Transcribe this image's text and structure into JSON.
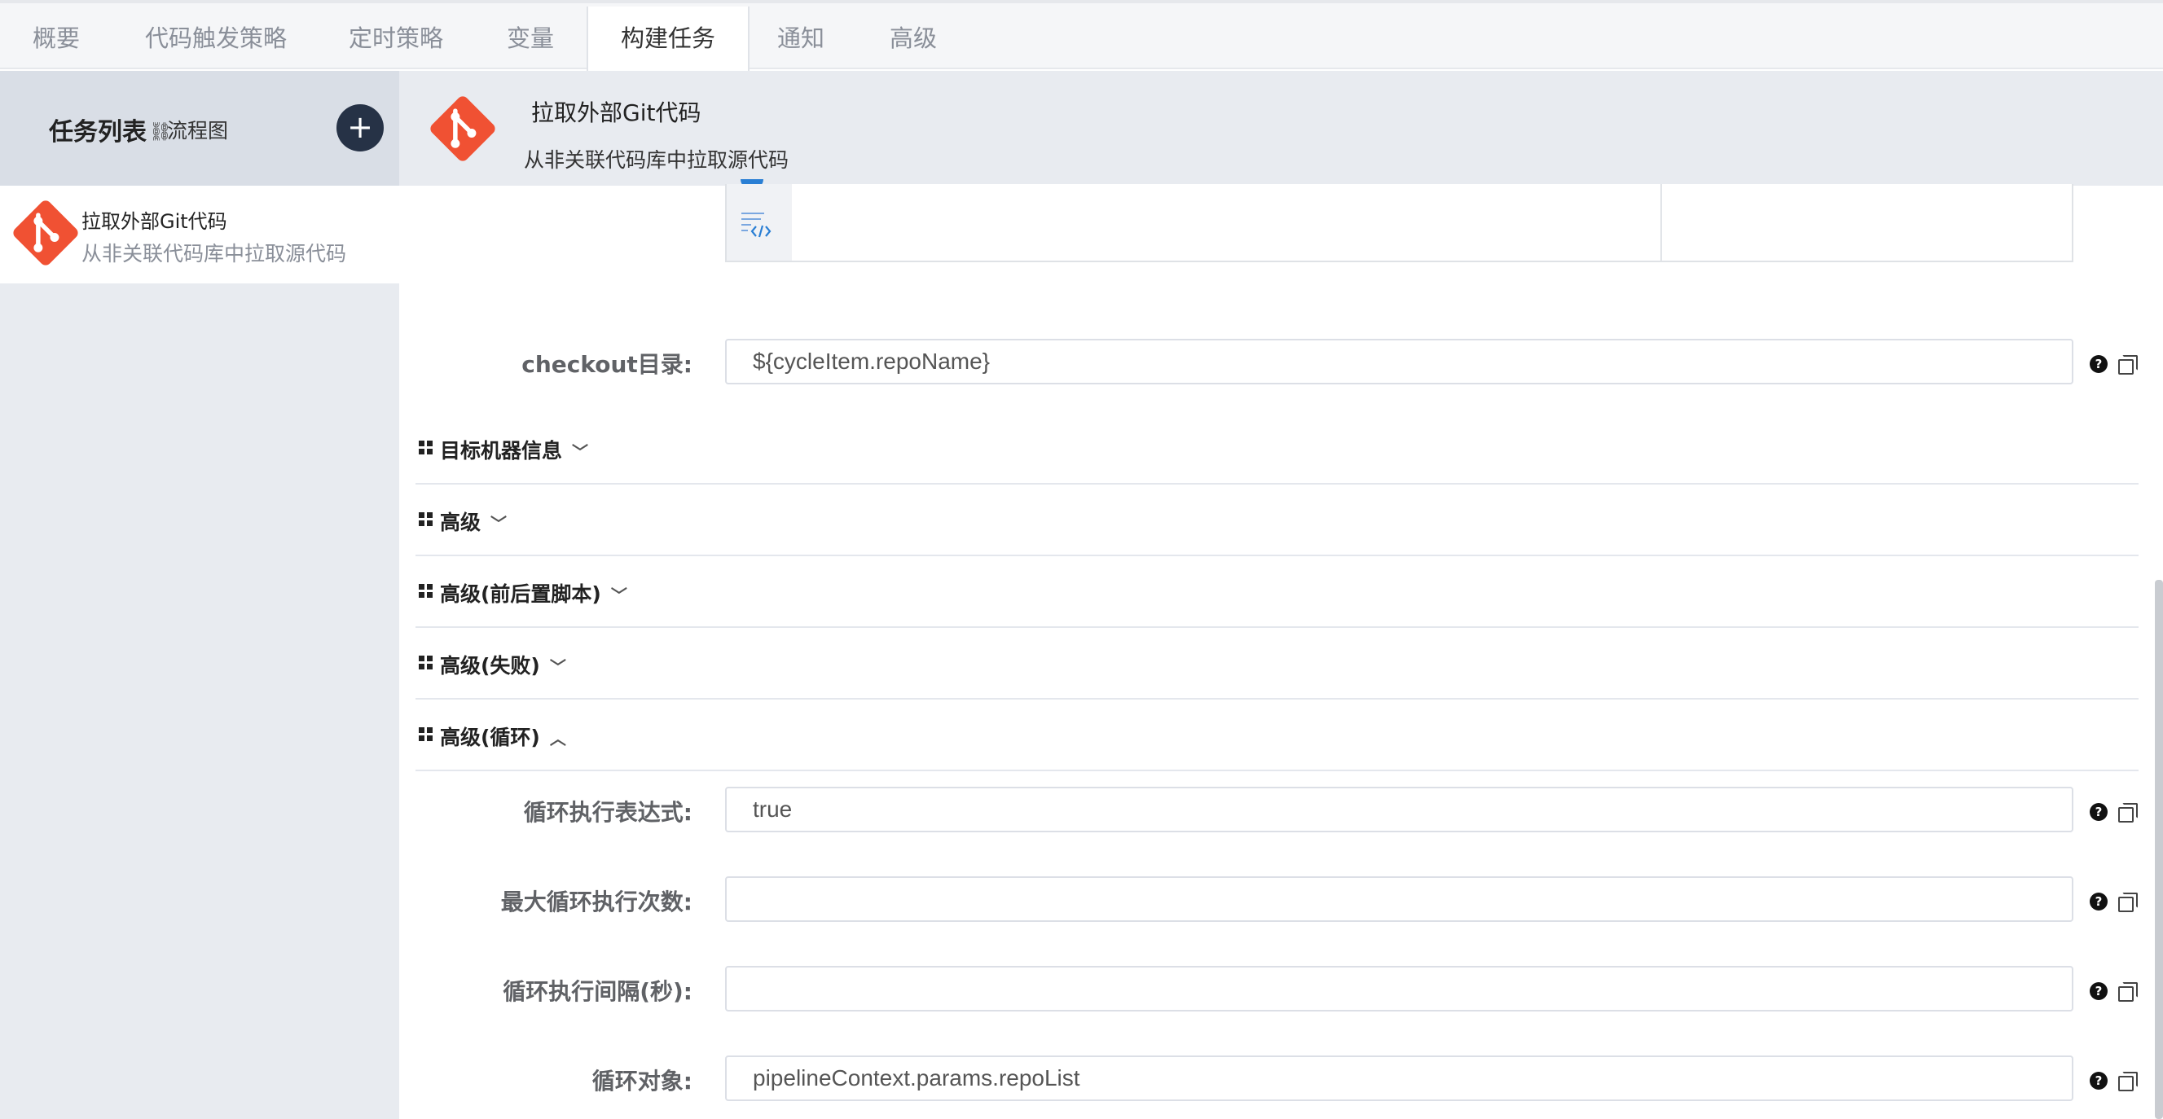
{
  "tabs": [
    "概要",
    "代码触发策略",
    "定时策略",
    "变量",
    "构建任务",
    "通知",
    "高级"
  ],
  "active_tab_index": 4,
  "sidebar": {
    "title": "任务列表",
    "flow_link": "流程图",
    "add_button": "+",
    "tasks": [
      {
        "name": "拉取外部Git代码",
        "desc": "从非关联代码库中拉取源代码"
      }
    ]
  },
  "task_header": {
    "title": "拉取外部Git代码",
    "desc": "从非关联代码库中拉取源代码"
  },
  "fields": {
    "checkout_dir": {
      "label": "checkout目录:",
      "value": "${cycleItem.repoName}"
    },
    "loop_expr": {
      "label": "循环执行表达式:",
      "value": "true"
    },
    "max_loops": {
      "label": "最大循环执行次数:",
      "value": ""
    },
    "loop_interval": {
      "label": "循环执行间隔(秒):",
      "value": ""
    },
    "loop_object": {
      "label": "循环对象:",
      "value": "pipelineContext.params.repoList"
    }
  },
  "sections": [
    {
      "title": "目标机器信息",
      "expanded": false
    },
    {
      "title": "高级",
      "expanded": false
    },
    {
      "title": "高级(前后置脚本)",
      "expanded": false
    },
    {
      "title": "高级(失败)",
      "expanded": false
    },
    {
      "title": "高级(循环)",
      "expanded": true
    }
  ],
  "help_icon_glyph": "?",
  "colors": {
    "git_logo": "#f05133",
    "add_button": "#263246"
  }
}
